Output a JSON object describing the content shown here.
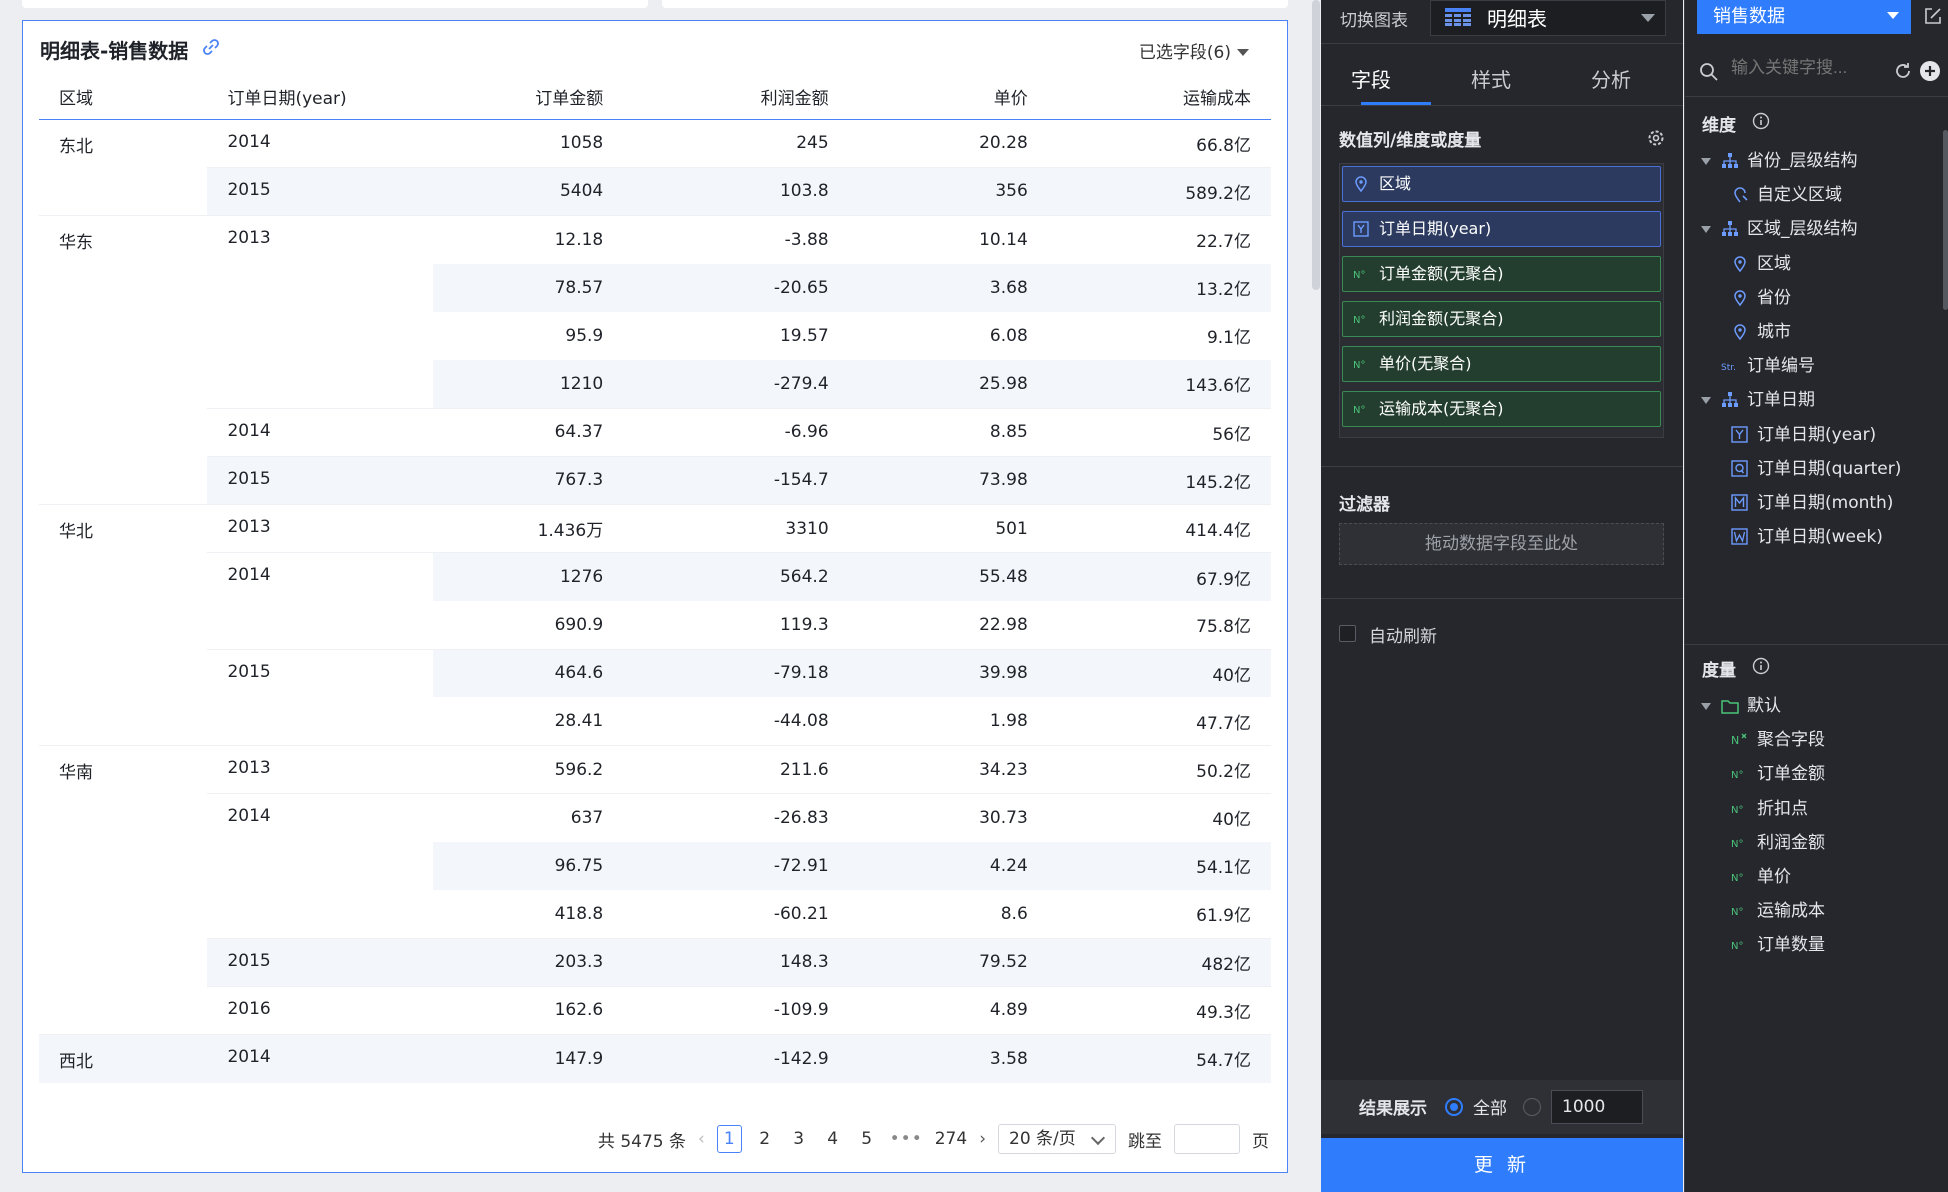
{
  "widget": {
    "title": "明细表-销售数据",
    "field_selector": "已选字段(6)"
  },
  "table": {
    "columns": [
      "区域",
      "订单日期(year)",
      "订单金额",
      "利润金额",
      "单价",
      "运输成本"
    ],
    "rows": [
      {
        "region": "东北",
        "year": "2014",
        "amount": "1058",
        "profit": "245",
        "price": "20.28",
        "cost": "66.8亿"
      },
      {
        "region": "",
        "year": "2015",
        "amount": "5404",
        "profit": "103.8",
        "price": "356",
        "cost": "589.2亿"
      },
      {
        "region": "华东",
        "year": "2013",
        "amount": "12.18",
        "profit": "-3.88",
        "price": "10.14",
        "cost": "22.7亿"
      },
      {
        "region": "",
        "year": "",
        "amount": "78.57",
        "profit": "-20.65",
        "price": "3.68",
        "cost": "13.2亿"
      },
      {
        "region": "",
        "year": "",
        "amount": "95.9",
        "profit": "19.57",
        "price": "6.08",
        "cost": "9.1亿"
      },
      {
        "region": "",
        "year": "",
        "amount": "1210",
        "profit": "-279.4",
        "price": "25.98",
        "cost": "143.6亿"
      },
      {
        "region": "",
        "year": "2014",
        "amount": "64.37",
        "profit": "-6.96",
        "price": "8.85",
        "cost": "56亿"
      },
      {
        "region": "",
        "year": "2015",
        "amount": "767.3",
        "profit": "-154.7",
        "price": "73.98",
        "cost": "145.2亿"
      },
      {
        "region": "华北",
        "year": "2013",
        "amount": "1.436万",
        "profit": "3310",
        "price": "501",
        "cost": "414.4亿"
      },
      {
        "region": "",
        "year": "2014",
        "amount": "1276",
        "profit": "564.2",
        "price": "55.48",
        "cost": "67.9亿"
      },
      {
        "region": "",
        "year": "",
        "amount": "690.9",
        "profit": "119.3",
        "price": "22.98",
        "cost": "75.8亿"
      },
      {
        "region": "",
        "year": "2015",
        "amount": "464.6",
        "profit": "-79.18",
        "price": "39.98",
        "cost": "40亿"
      },
      {
        "region": "",
        "year": "",
        "amount": "28.41",
        "profit": "-44.08",
        "price": "1.98",
        "cost": "47.7亿"
      },
      {
        "region": "华南",
        "year": "2013",
        "amount": "596.2",
        "profit": "211.6",
        "price": "34.23",
        "cost": "50.2亿"
      },
      {
        "region": "",
        "year": "2014",
        "amount": "637",
        "profit": "-26.83",
        "price": "30.73",
        "cost": "40亿"
      },
      {
        "region": "",
        "year": "",
        "amount": "96.75",
        "profit": "-72.91",
        "price": "4.24",
        "cost": "54.1亿"
      },
      {
        "region": "",
        "year": "",
        "amount": "418.8",
        "profit": "-60.21",
        "price": "8.6",
        "cost": "61.9亿"
      },
      {
        "region": "",
        "year": "2015",
        "amount": "203.3",
        "profit": "148.3",
        "price": "79.52",
        "cost": "482亿"
      },
      {
        "region": "",
        "year": "2016",
        "amount": "162.6",
        "profit": "-109.9",
        "price": "4.89",
        "cost": "49.3亿"
      },
      {
        "region": "西北",
        "year": "2014",
        "amount": "147.9",
        "profit": "-142.9",
        "price": "3.58",
        "cost": "54.7亿"
      }
    ]
  },
  "pagination": {
    "total": "共 5475 条",
    "pages": [
      "1",
      "2",
      "3",
      "4",
      "5"
    ],
    "ellipsis": "•••",
    "last": "274",
    "page_size": "20 条/页",
    "jump_label": "跳至",
    "page_suffix": "页",
    "current": "1"
  },
  "config_panel": {
    "switch_chart_label": "切换图表",
    "chart_type": "明细表",
    "tabs": [
      "字段",
      "样式",
      "分析"
    ],
    "active_tab": "字段",
    "fields_section": "数值列/维度或度量",
    "fields": [
      {
        "label": "区域",
        "kind": "dimension",
        "icon": "location-icon"
      },
      {
        "label": "订单日期(year)",
        "kind": "dimension",
        "icon": "year-icon"
      },
      {
        "label": "订单金额(无聚合)",
        "kind": "measure",
        "icon": "number-icon"
      },
      {
        "label": "利润金额(无聚合)",
        "kind": "measure",
        "icon": "number-icon"
      },
      {
        "label": "单价(无聚合)",
        "kind": "measure",
        "icon": "number-icon"
      },
      {
        "label": "运输成本(无聚合)",
        "kind": "measure",
        "icon": "number-icon"
      }
    ],
    "filter_section": "过滤器",
    "filter_placeholder": "拖动数据字段至此处",
    "auto_refresh": "自动刷新",
    "result_label": "结果展示",
    "result_all": "全部",
    "result_limit": "1000",
    "update_button": "更 新"
  },
  "data_panel": {
    "dataset": "销售数据",
    "search_placeholder": "输入关键字搜...",
    "dimensions_label": "维度",
    "dimension_tree": [
      {
        "label": "省份_层级结构",
        "icon": "hierarchy-icon",
        "level": 0,
        "expanded": true
      },
      {
        "label": "自定义区域",
        "icon": "custom-region-icon",
        "level": 1
      },
      {
        "label": "区域_层级结构",
        "icon": "hierarchy-icon",
        "level": 0,
        "expanded": true
      },
      {
        "label": "区域",
        "icon": "location-icon",
        "level": 1
      },
      {
        "label": "省份",
        "icon": "location-icon",
        "level": 1
      },
      {
        "label": "城市",
        "icon": "location-icon",
        "level": 1
      },
      {
        "label": "订单编号",
        "icon": "string-icon",
        "level": 0
      },
      {
        "label": "订单日期",
        "icon": "hierarchy-icon",
        "level": 0,
        "expanded": true
      },
      {
        "label": "订单日期(year)",
        "icon": "year-icon",
        "level": 1
      },
      {
        "label": "订单日期(quarter)",
        "icon": "quarter-icon",
        "level": 1
      },
      {
        "label": "订单日期(month)",
        "icon": "month-icon",
        "level": 1
      },
      {
        "label": "订单日期(week)",
        "icon": "week-icon",
        "level": 1
      }
    ],
    "measures_label": "度量",
    "measure_tree": [
      {
        "label": "默认",
        "icon": "folder-icon",
        "level": 0,
        "expanded": true
      },
      {
        "label": "聚合字段",
        "icon": "aggregate-icon",
        "level": 1
      },
      {
        "label": "订单金额",
        "icon": "number-icon",
        "level": 1
      },
      {
        "label": "折扣点",
        "icon": "number-icon",
        "level": 1
      },
      {
        "label": "利润金额",
        "icon": "number-icon",
        "level": 1
      },
      {
        "label": "单价",
        "icon": "number-icon",
        "level": 1
      },
      {
        "label": "运输成本",
        "icon": "number-icon",
        "level": 1
      },
      {
        "label": "订单数量",
        "icon": "number-icon",
        "level": 1
      }
    ]
  },
  "colors": {
    "accent": "#2f7dfd",
    "dimension": "#4a6fd6",
    "measure": "#3a8a55",
    "panel_dark": "#25272c",
    "stripe": "#f3f6fb"
  }
}
